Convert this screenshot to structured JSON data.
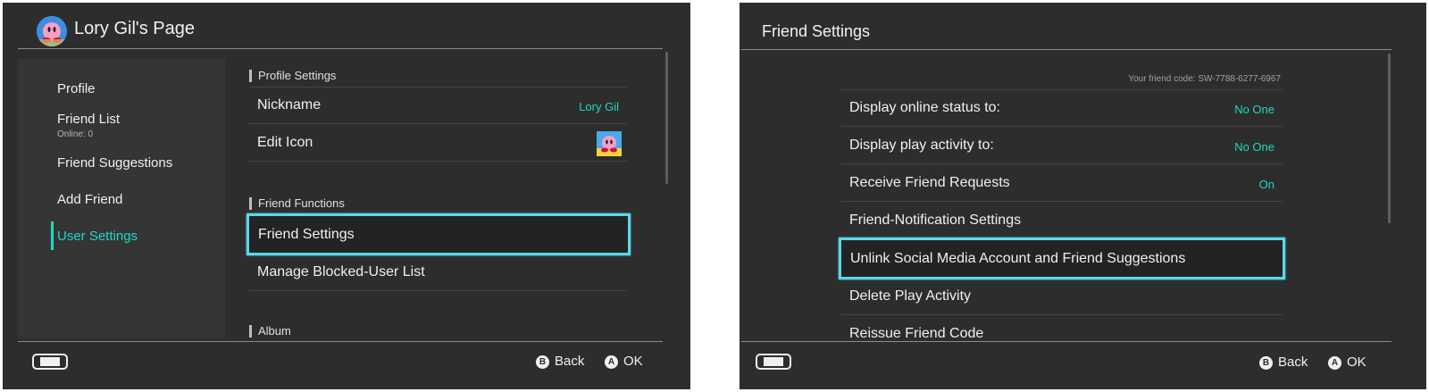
{
  "left": {
    "title": "Lory Gil's Page",
    "sidebar": {
      "items": [
        {
          "label": "Profile"
        },
        {
          "label": "Friend List",
          "sub": "Online: 0"
        },
        {
          "label": "Friend Suggestions"
        },
        {
          "label": "Add Friend"
        },
        {
          "label": "User Settings"
        }
      ]
    },
    "sections": [
      {
        "label": "Profile Settings",
        "rows": [
          {
            "label": "Nickname",
            "value": "Lory Gil"
          },
          {
            "label": "Edit Icon"
          }
        ]
      },
      {
        "label": "Friend Functions",
        "rows": [
          {
            "label": "Friend Settings"
          },
          {
            "label": "Manage Blocked-User List"
          }
        ]
      },
      {
        "label": "Album"
      }
    ],
    "footer": {
      "back": "Back",
      "ok": "OK",
      "back_key": "B",
      "ok_key": "A"
    }
  },
  "right": {
    "title": "Friend Settings",
    "friend_code": "Your friend code: SW-7788-6277-6967",
    "rows": [
      {
        "label": "Display online status to:",
        "value": "No One"
      },
      {
        "label": "Display play activity to:",
        "value": "No One"
      },
      {
        "label": "Receive Friend Requests",
        "value": "On"
      },
      {
        "label": "Friend-Notification Settings"
      },
      {
        "label": "Unlink Social Media Account and Friend Suggestions"
      },
      {
        "label": "Delete Play Activity"
      },
      {
        "label": "Reissue Friend Code"
      }
    ],
    "footer": {
      "back": "Back",
      "ok": "OK",
      "back_key": "B",
      "ok_key": "A"
    }
  },
  "colors": {
    "accent": "#1fd8c3",
    "selection": "#5ad8ea",
    "background": "#2d2d2d"
  },
  "icons": [
    "avatar-kirby",
    "console-handheld-icon"
  ]
}
